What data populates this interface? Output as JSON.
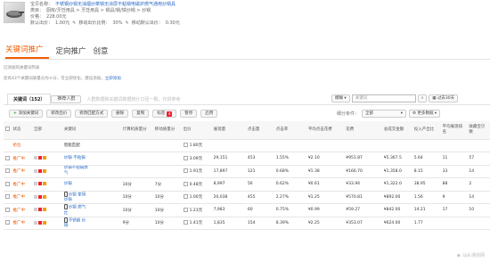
{
  "product": {
    "title_label": "宝贝名称：",
    "title": "不锈钢炒锅无油烟炒菜锅无涂层不粘锅电磁炉燃气通用炒锅具",
    "category_label": "类目：",
    "category": "厨房/烹饪用具 > 烹饪用具 > 锅具/锅/铁炒锅 > 炒锅",
    "price_label": "价格：",
    "price": "228.00元",
    "default_bid_label": "默认出价：",
    "default_bid": "1.00元",
    "mobile_ratio_label": "移动出价比例：",
    "mobile_ratio": "30%",
    "mobile_bid_label": "移动默认出价：",
    "mobile_bid": "0.30元"
  },
  "main_tabs": [
    "关键词推广",
    "定向推广",
    "创意"
  ],
  "notices": {
    "line1": "已添加的关键词列表",
    "line2": "您有43个关键词质量分为十分，可立即优化，建议添加，",
    "line2_link": "立即添加"
  },
  "keyword_tabs": [
    "关键词（152）",
    "推荐人群"
  ],
  "filter_hint": "人群数据和关键词数据统计口径一致，仅供参考",
  "search": {
    "mode": "模糊",
    "placeholder": "关键词",
    "period": "过去30天",
    "device_label": "细分条件：",
    "device_value": "全部",
    "more_label": "更多数据"
  },
  "toolbar": [
    "添加关键词",
    "修改出价",
    "修改匹配方式",
    "删除",
    "复制",
    "标签",
    "暂停",
    "启用"
  ],
  "table": {
    "headers": [
      "状态",
      "全部",
      "关键词",
      "",
      "计算机质量分",
      "移动质量分",
      "出价",
      "展现量",
      "点击量",
      "点击率",
      "平均点击花费",
      "花费",
      "总成交金额",
      "投入产出比",
      "平均展现排名",
      "收藏宝贝数"
    ],
    "rows": [
      {
        "status": "",
        "dots": [],
        "kw": "",
        "device": "",
        "pc": "",
        "mobile": "",
        "bid": "",
        "impr": "",
        "clicks": "",
        "ctr": "",
        "cpc": "",
        "spend": "",
        "gmv": "",
        "roi": "",
        "rank": "",
        "fav": ""
      },
      {
        "status": "推广中",
        "dots": [
          "#cfcfcf",
          "#e23",
          "#f90"
        ],
        "kw": "炒锅 不粘锅",
        "device": "",
        "pc": "",
        "mobile": "",
        "bid": "3.09元",
        "impr": "29,151",
        "clicks": "453",
        "ctr": "1.55%",
        "cpc": "¥2.10",
        "spend": "¥951.87",
        "gmv": "¥5,367.5",
        "roi": "5.64",
        "rank": "11",
        "fav": "57"
      },
      {
        "status": "推广中",
        "dots": [
          "#cfcfcf",
          "#e23",
          "#f90"
        ],
        "kw": "炒锅不粘锅燃气",
        "device": "",
        "pc": "",
        "mobile": "",
        "bid": "1.91元",
        "impr": "17,897",
        "clicks": "121",
        "ctr": "0.68%",
        "cpc": "¥1.38",
        "spend": "¥166.70",
        "gmv": "¥1,358.0",
        "roi": "8.15",
        "rank": "33",
        "fav": "14"
      },
      {
        "status": "推广中",
        "dots": [
          "#cfcfcf",
          "#e23",
          "#f90"
        ],
        "kw": "炒锅",
        "device": "",
        "pc": "10分",
        "mobile": "7分",
        "bid": "0.48元",
        "impr": "8,997",
        "clicks": "56",
        "ctr": "0.62%",
        "cpc": "¥0.61",
        "spend": "¥33.94",
        "gmv": "¥1,322.0",
        "roi": "38.95",
        "rank": "88",
        "fav": "2"
      },
      {
        "status": "推广中",
        "dots": [
          "#cfcfcf",
          "#e23",
          "#f90"
        ],
        "kw": "炒锅 家用炒锅",
        "device": "",
        "pc": "10分",
        "mobile": "10分",
        "bid": "1.00元",
        "impr": "20,038",
        "clicks": "455",
        "ctr": "2.27%",
        "cpc": "¥1.25",
        "spend": "¥570.81",
        "gmv": "¥892.00",
        "roi": "1.56",
        "rank": "9",
        "fav": "14"
      },
      {
        "status": "推广中",
        "dots": [
          "#cfcfcf",
          "#e23",
          "#f90"
        ],
        "kw": "炒锅 燃气灶",
        "device": "",
        "pc": "10分",
        "mobile": "10分",
        "bid": "1.23元",
        "impr": "7,983",
        "clicks": "60",
        "ctr": "0.75%",
        "cpc": "¥0.99",
        "spend": "¥59.27",
        "gmv": "¥842.00",
        "roi": "14.21",
        "rank": "17",
        "fav": "10"
      },
      {
        "status": "推广中",
        "dots": [
          "#cfcfcf",
          "#e23",
          "#f90"
        ],
        "kw": "不锈钢 炒锅",
        "device": "",
        "pc": "9分",
        "mobile": "10分",
        "bid": "1.41元",
        "impr": "1,835",
        "clicks": "154",
        "ctr": "8.39%",
        "cpc": "¥2.25",
        "spend": "¥353.07",
        "gmv": "¥624.00",
        "roi": "1.77",
        "rank": "",
        "fav": ""
      }
    ],
    "smart_row": {
      "status": "抢位",
      "kw": "智能匹配",
      "bid": "1.80元"
    }
  },
  "watermark": "汕头通信网"
}
